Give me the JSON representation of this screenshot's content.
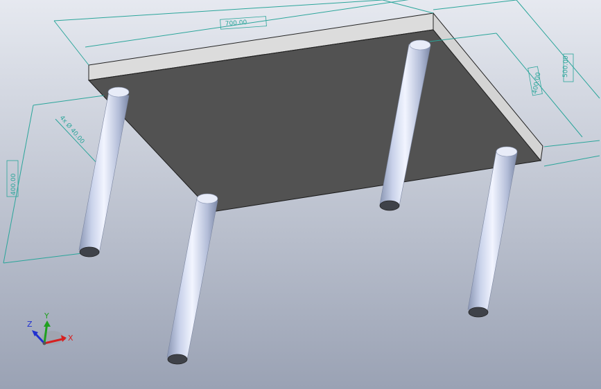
{
  "viewport": {
    "background_top": "#e6e9f0",
    "background_bottom": "#9aa2b4"
  },
  "colors": {
    "dimension_line": "#2aa59a",
    "table_top_underside": "#525252",
    "table_top_edge": "#d9d9d9",
    "leg_highlight": "#f2f5ff",
    "leg_shadow": "#8a96b3",
    "leg_end": "#3f4249",
    "axis_x": "#d62020",
    "axis_y": "#20a020",
    "axis_z": "#2030d0"
  },
  "dimensions": {
    "top_length": "700.00",
    "top_width": "500.00",
    "leg_spacing": "400.00",
    "leg_diameter": "4x Ø 40.00",
    "leg_length": "400.00"
  },
  "triad": {
    "x_label": "X",
    "y_label": "Y",
    "z_label": "Z"
  }
}
